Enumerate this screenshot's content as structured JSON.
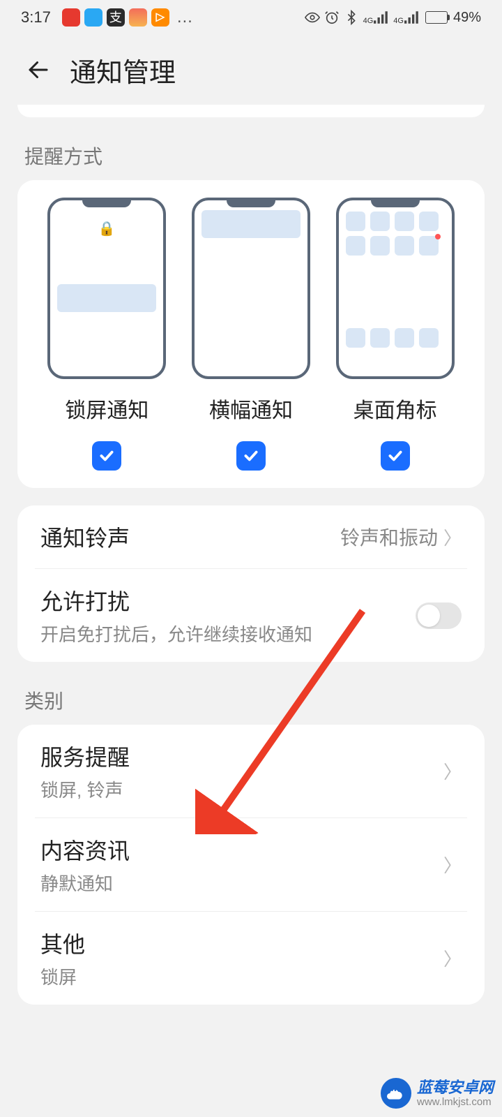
{
  "status_bar": {
    "time": "3:17",
    "app_icon_colors": [
      "#e6392f",
      "#2aa8f3",
      "#2b2b2b",
      "#f36d5a",
      "#ff8a00"
    ],
    "ellipsis": "…",
    "sig_4g": "4G",
    "battery_percent": "49%"
  },
  "header": {
    "title": "通知管理"
  },
  "section_notify_types": {
    "label": "提醒方式",
    "items": [
      {
        "label": "锁屏通知"
      },
      {
        "label": "横幅通知"
      },
      {
        "label": "桌面角标"
      }
    ]
  },
  "settings": {
    "ringtone": {
      "title": "通知铃声",
      "value": "铃声和振动"
    },
    "disturb": {
      "title": "允许打扰",
      "sub": "开启免打扰后，允许继续接收通知"
    }
  },
  "categories": {
    "label": "类别",
    "items": [
      {
        "title": "服务提醒",
        "sub": "锁屏, 铃声"
      },
      {
        "title": "内容资讯",
        "sub": "静默通知"
      },
      {
        "title": "其他",
        "sub": "锁屏"
      }
    ]
  },
  "watermark": {
    "title": "蓝莓安卓网",
    "url": "www.lmkjst.com"
  }
}
